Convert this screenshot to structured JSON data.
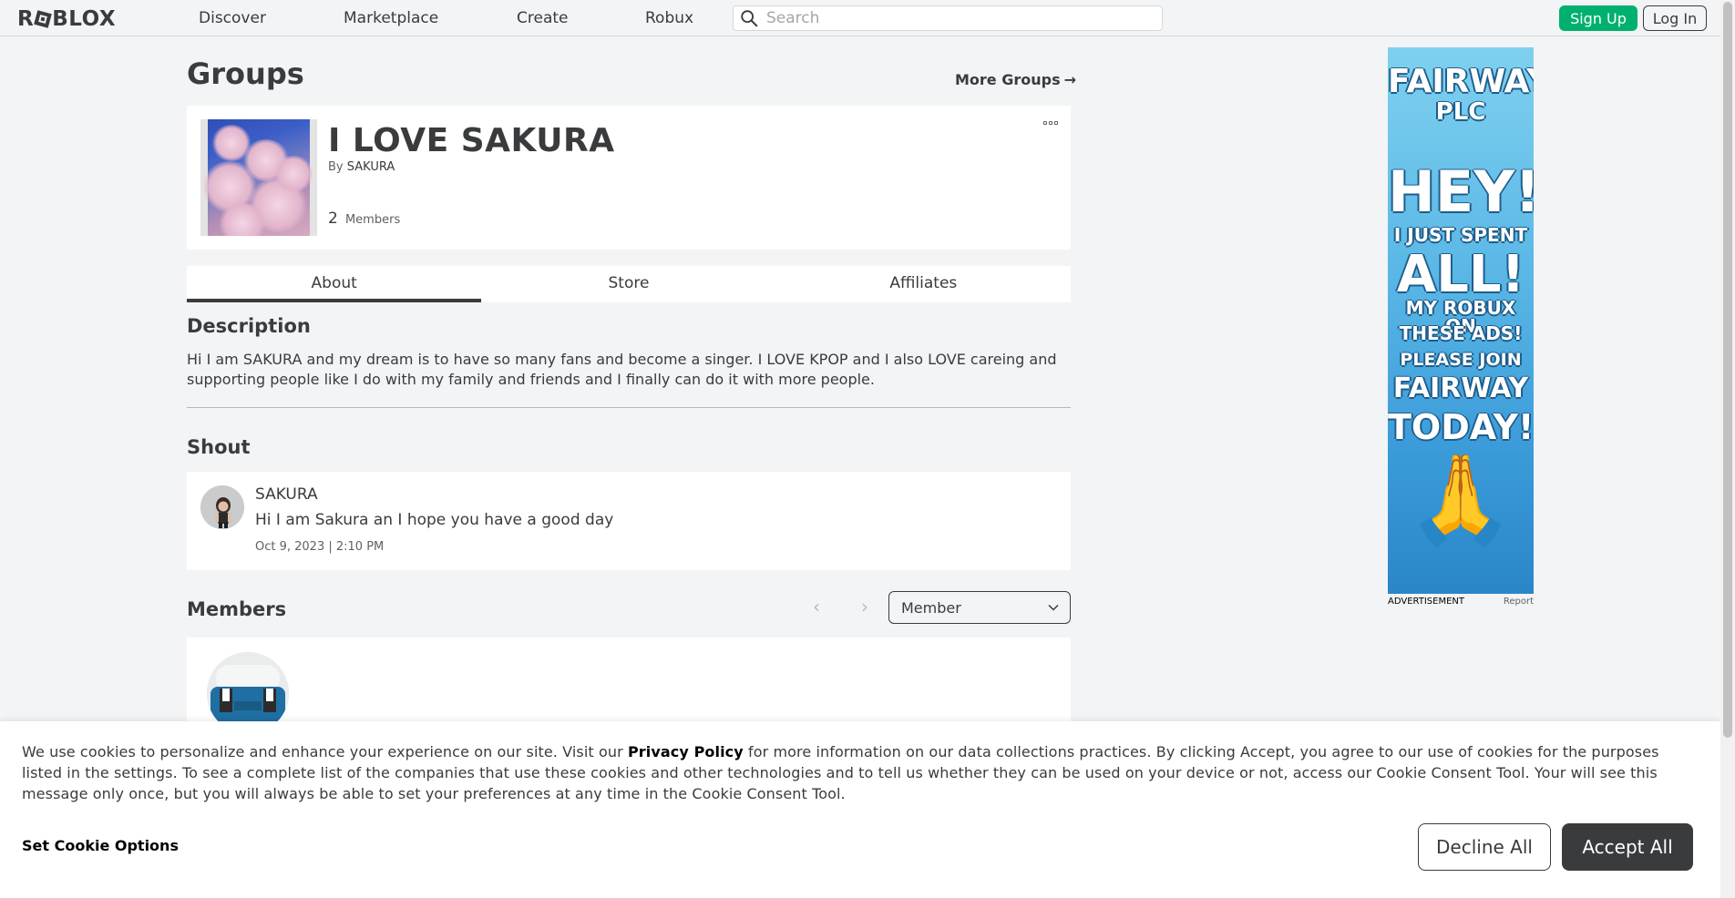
{
  "header": {
    "logo_text_left": "R",
    "logo_text_right": "BLOX",
    "nav": [
      "Discover",
      "Marketplace",
      "Create",
      "Robux"
    ],
    "search_placeholder": "Search",
    "signup_label": "Sign Up",
    "login_label": "Log In"
  },
  "page": {
    "title": "Groups",
    "more_groups": "More Groups",
    "more_groups_arrow": "→"
  },
  "group": {
    "name": "I LOVE SAKURA",
    "by_label": "By",
    "owner": "SAKURA",
    "member_count": "2",
    "members_label": "Members"
  },
  "tabs": [
    "About",
    "Store",
    "Affiliates"
  ],
  "about": {
    "description_title": "Description",
    "description": "Hi I am SAKURA and my dream is to have so many fans and become a singer. I LOVE KPOP and I also LOVE careing and supporting people like I do with my family and friends and I finally can do it with more people."
  },
  "shout": {
    "title": "Shout",
    "author": "SAKURA",
    "body": "Hi I am Sakura an I hope you have a good day",
    "date": "Oct 9, 2023 | 2:10 PM"
  },
  "members": {
    "title": "Members",
    "role_selected": "Member"
  },
  "ad": {
    "lines": [
      "FAIRWAY",
      "PLC",
      "HEY!",
      "I JUST SPENT",
      "ALL!",
      "MY ROBUX ON",
      "THESE ADS!",
      "PLEASE JOIN",
      "FAIRWAY",
      "TODAY!"
    ],
    "emoji": "🙏",
    "label": "ADVERTISEMENT",
    "report": "Report"
  },
  "cookie": {
    "text_before": "We use cookies to personalize and enhance your experience on our site. Visit our ",
    "privacy_link": "Privacy Policy",
    "text_after": " for more information on our data collections practices. By clicking Accept, you agree to our use of cookies for the purposes listed in the settings. To see a complete list of the companies that use these cookies and other technologies and to tell us whether they can be used on your device or not, access our Cookie Consent Tool. Your will see this message only once, but you will always be able to set your preferences at any time in the Cookie Consent Tool.",
    "options_label": "Set Cookie Options",
    "decline_label": "Decline All",
    "accept_label": "Accept All"
  },
  "colors": {
    "signup_green": "#00b06f",
    "text_primary": "#393b3d",
    "page_bg": "#f2f4f5"
  }
}
